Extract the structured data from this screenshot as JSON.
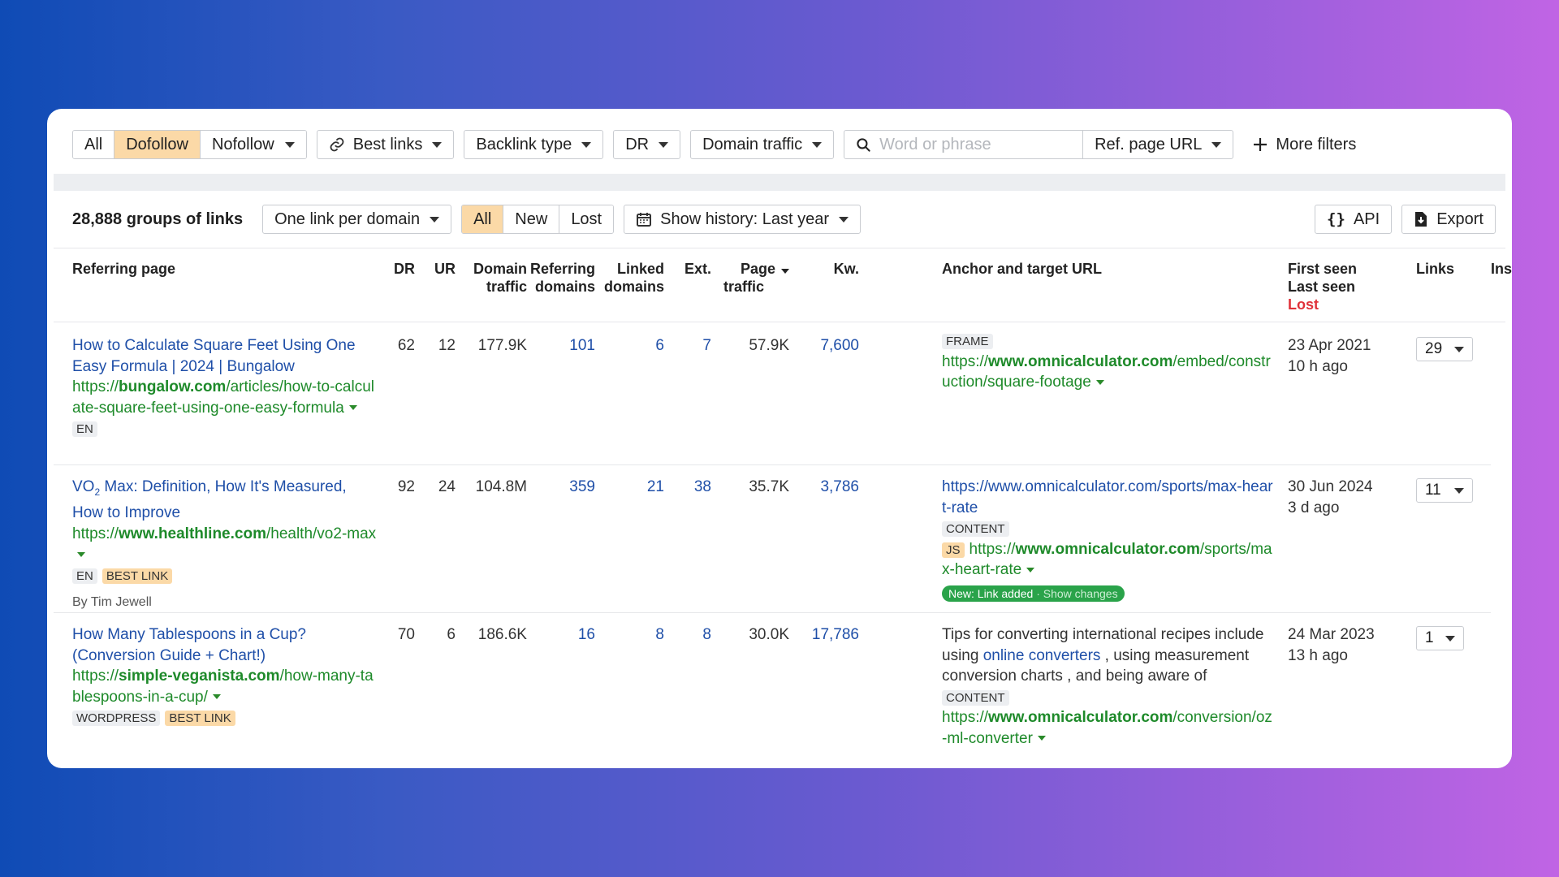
{
  "filters": {
    "all": "All",
    "dofollow": "Dofollow",
    "nofollow": "Nofollow",
    "best_links": "Best links",
    "backlink_type": "Backlink type",
    "dr": "DR",
    "domain_traffic": "Domain traffic",
    "search_placeholder": "Word or phrase",
    "ref_page_url": "Ref. page URL",
    "more_filters": "More filters"
  },
  "toolbar": {
    "groups": "28,888 groups of links",
    "grouping": "One link per domain",
    "tab_all": "All",
    "tab_new": "New",
    "tab_lost": "Lost",
    "history": "Show history: Last year",
    "api": "API",
    "export": "Export"
  },
  "columns": {
    "referring_page": "Referring page",
    "dr": "DR",
    "ur": "UR",
    "domain_traffic_1": "Domain",
    "domain_traffic_2": "traffic",
    "referring_domains_1": "Referring",
    "referring_domains_2": "domains",
    "linked_domains_1": "Linked",
    "linked_domains_2": "domains",
    "ext": "Ext.",
    "page_traffic_1": "Page",
    "page_traffic_2": "traffic",
    "kw": "Kw.",
    "anchor": "Anchor and target URL",
    "first_seen": "First seen",
    "last_seen": "Last seen",
    "lost": "Lost",
    "links": "Links",
    "inspect": "Inspect"
  },
  "rows": [
    {
      "title": "How to Calculate Square Feet Using One Easy Formula | 2024 | Bungalow",
      "url_pre": "https://",
      "url_domain": "bungalow.com",
      "url_path": "/articles/how-to-calculate-square-feet-using-one-easy-formula",
      "tag1": "EN",
      "dr": "62",
      "ur": "12",
      "domain_traffic": "177.9K",
      "ref_domains": "101",
      "linked_domains": "6",
      "ext": "7",
      "page_traffic": "57.9K",
      "kw": "7,600",
      "anchor_tag": "FRAME",
      "target_pre": "https://",
      "target_domain": "www.omnicalculator.com",
      "target_path": "/embed/construction/square-footage",
      "first_seen": "23 Apr 2021",
      "last_seen": "10 h ago",
      "links": "29"
    },
    {
      "title_a": "VO",
      "title_sub": "2",
      "title_b": " Max: Definition, How It's Measured, How to Improve",
      "url_pre": "https://",
      "url_domain": "www.healthline.com",
      "url_path": "/health/vo2-max",
      "tag1": "EN",
      "tag2": "BEST LINK",
      "author": "By Tim Jewell",
      "dr": "92",
      "ur": "24",
      "domain_traffic": "104.8M",
      "ref_domains": "359",
      "linked_domains": "21",
      "ext": "38",
      "page_traffic": "35.7K",
      "kw": "3,786",
      "anchor_url": "https://www.omnicalculator.com/sports/max-heart-rate",
      "anchor_tag": "CONTENT",
      "js_tag": "JS",
      "target_pre": "https://",
      "target_domain": "www.omnicalculator.com",
      "target_path": "/sports/max-heart-rate",
      "new_badge": "New: Link added",
      "show_changes": "· Show changes",
      "first_seen": "30 Jun 2024",
      "last_seen": "3 d ago",
      "links": "11"
    },
    {
      "title": "How Many Tablespoons in a Cup? (Conversion Guide + Chart!)",
      "url_pre": "https://",
      "url_domain": "simple-veganista.com",
      "url_path": "/how-many-tablespoons-in-a-cup/",
      "tag1": "WORDPRESS",
      "tag2": "BEST LINK",
      "dr": "70",
      "ur": "6",
      "domain_traffic": "186.6K",
      "ref_domains": "16",
      "linked_domains": "8",
      "ext": "8",
      "page_traffic": "30.0K",
      "kw": "17,786",
      "anchor_text_a": "Tips for converting international recipes include using ",
      "anchor_link": "online converters",
      "anchor_text_b": " , using measurement conversion charts , and being aware of",
      "anchor_tag": "CONTENT",
      "target_pre": "https://",
      "target_domain": "www.omnicalculator.com",
      "target_path": "/conversion/oz-ml-converter",
      "first_seen": "24 Mar 2023",
      "last_seen": "13 h ago",
      "links": "1"
    }
  ],
  "icons": [
    "link-icon",
    "search-icon",
    "plus-icon",
    "calendar-icon",
    "api-braces-icon",
    "export-icon",
    "magnifier-icon"
  ]
}
